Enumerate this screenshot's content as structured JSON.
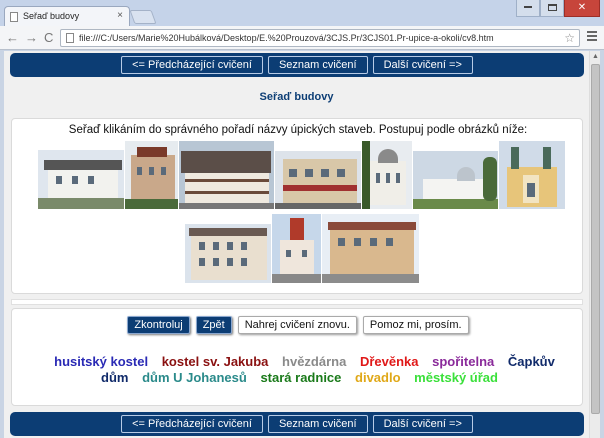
{
  "browser": {
    "tab_title": "Seřaď budovy",
    "tab_close": "×",
    "url": "file:///C:/Users/Marie%20Hubálková/Desktop/E.%20Prouzová/3CJS.Pr/3CJS01.Pr-upice-a-okoli/cv8.htm",
    "back_glyph": "←",
    "forward_glyph": "→",
    "reload_glyph": "C",
    "star_glyph": "☆",
    "close_glyph": "✕"
  },
  "nav": {
    "prev": "<= Předcházející cvičení",
    "list": "Seznam cvičení",
    "next": "Další cvičení =>"
  },
  "page": {
    "heading": "Seřaď budovy",
    "instructions": "Seřaď klikáním do správného pořadí názvy úpických staveb. Postupuj podle obrázků níže:"
  },
  "actions": {
    "check": "Zkontroluj",
    "back": "Zpět",
    "reload": "Nahrej cvičení znovu.",
    "help": "Pomoz mi, prosím."
  },
  "words": [
    {
      "text": "husitský kostel",
      "color": "#2a2ab5"
    },
    {
      "text": "kostel sv. Jakuba",
      "color": "#8a1010"
    },
    {
      "text": "hvězdárna",
      "color": "#8a8a8a"
    },
    {
      "text": "Dřevěnka",
      "color": "#e01818"
    },
    {
      "text": "spořitelna",
      "color": "#8a2a9a"
    },
    {
      "text": "Čapkův dům",
      "color": "#102a6a"
    },
    {
      "text": "dům U Johanesů",
      "color": "#2a8a8a"
    },
    {
      "text": "stará radnice",
      "color": "#1a7a1a"
    },
    {
      "text": "divadlo",
      "color": "#e0a818"
    },
    {
      "text": "městský úřad",
      "color": "#3ae03a"
    }
  ],
  "icons": {
    "page": "page-icon",
    "star": "star-icon",
    "menu": "menu-icon",
    "minimize": "minimize-icon",
    "maximize": "maximize-icon",
    "close": "close-icon"
  }
}
